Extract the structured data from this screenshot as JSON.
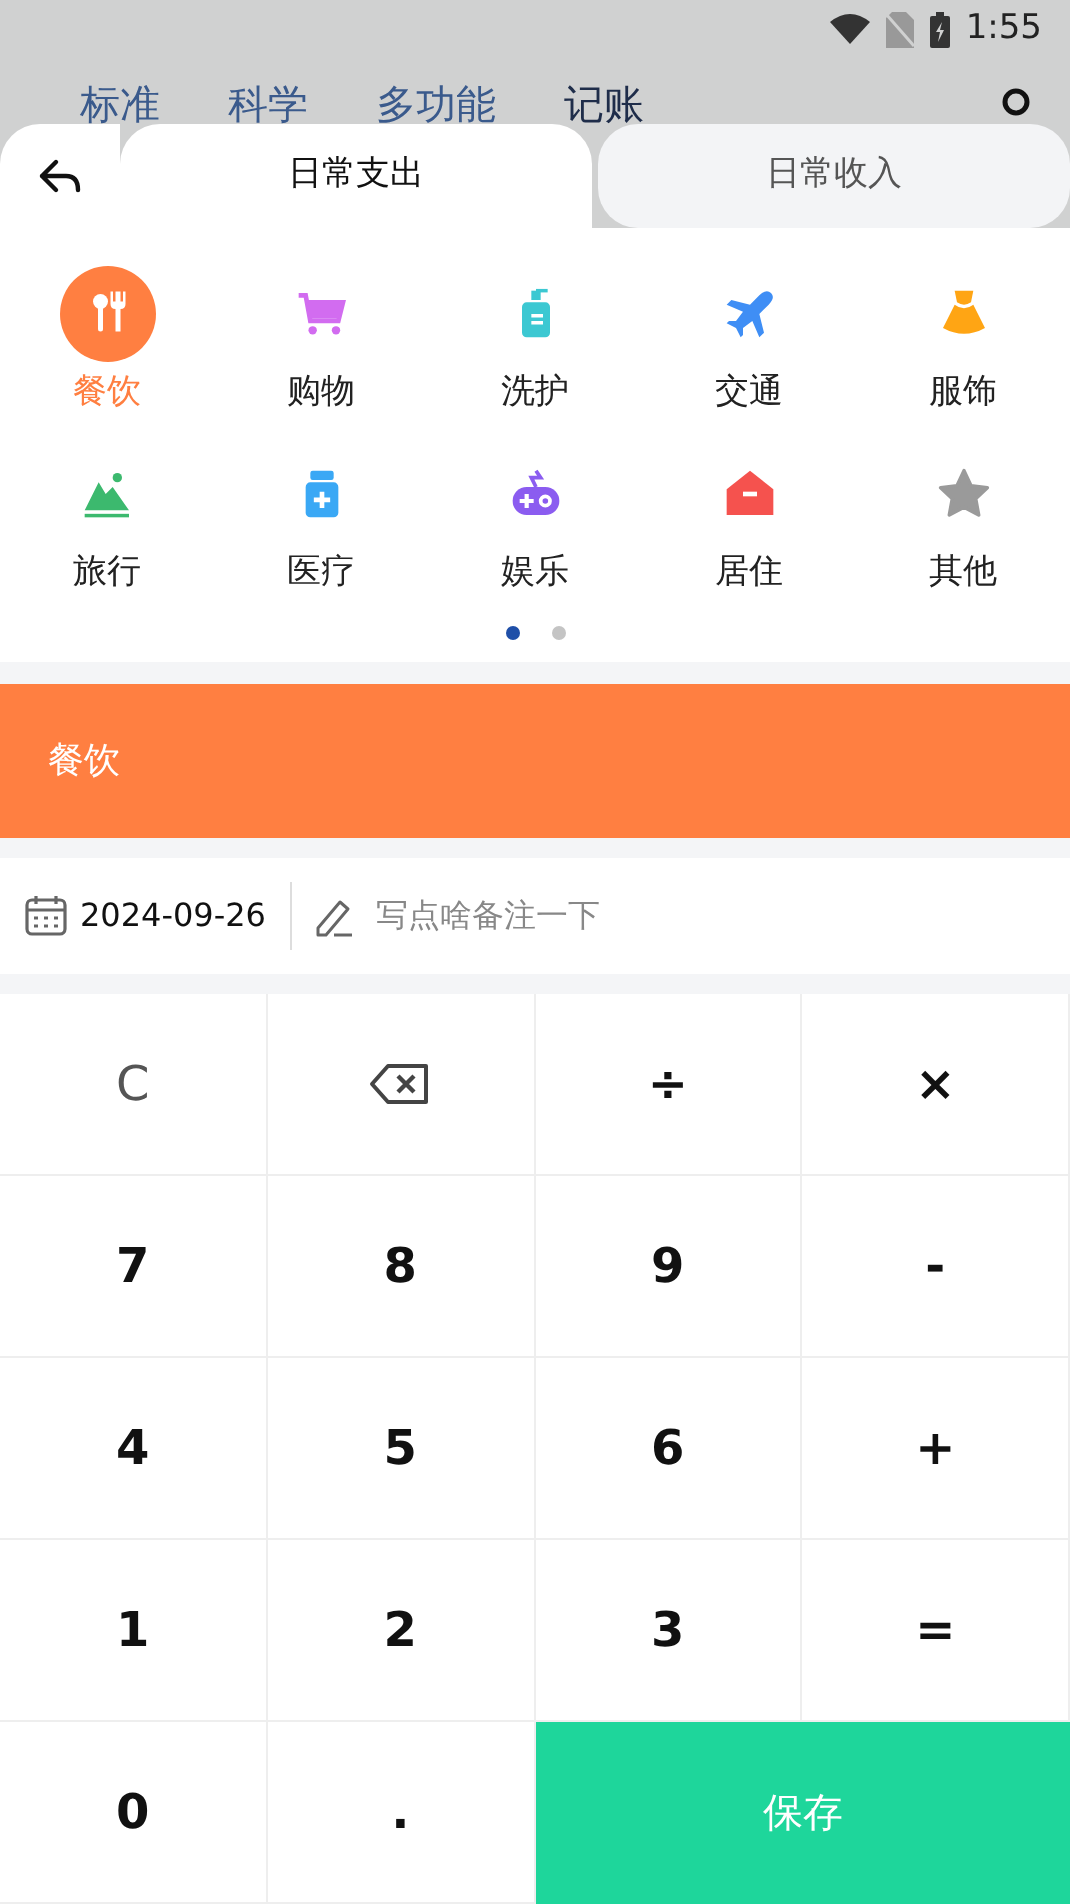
{
  "status_bar": {
    "time": "1:55"
  },
  "background_tabs": [
    {
      "label": "标准",
      "selected": false
    },
    {
      "label": "科学",
      "selected": false
    },
    {
      "label": "多功能",
      "selected": false
    },
    {
      "label": "记账",
      "selected": true
    }
  ],
  "tabs": [
    {
      "label": "日常支出",
      "selected": true
    },
    {
      "label": "日常收入",
      "selected": false
    }
  ],
  "categories": [
    {
      "label": "餐饮",
      "selected": true,
      "color": "#ff7f41"
    },
    {
      "label": "购物",
      "selected": false,
      "color": "#d26cf0"
    },
    {
      "label": "洗护",
      "selected": false,
      "color": "#3cc8d2"
    },
    {
      "label": "交通",
      "selected": false,
      "color": "#3f8ef5"
    },
    {
      "label": "服饰",
      "selected": false,
      "color": "#ffa514"
    },
    {
      "label": "旅行",
      "selected": false,
      "color": "#3cb96e"
    },
    {
      "label": "医疗",
      "selected": false,
      "color": "#3aa8f5"
    },
    {
      "label": "娱乐",
      "selected": false,
      "color": "#8b5cf0"
    },
    {
      "label": "居住",
      "selected": false,
      "color": "#f5524e"
    },
    {
      "label": "其他",
      "selected": false,
      "color": "#9a9a9a"
    }
  ],
  "page_dots": [
    {
      "selected": true
    },
    {
      "selected": false
    }
  ],
  "banner": {
    "label": "餐饮"
  },
  "entry": {
    "date": "2024-09-26",
    "placeholder": "写点啥备注一下"
  },
  "keypad": [
    {
      "kind": "text",
      "label": "C"
    },
    {
      "kind": "backspace"
    },
    {
      "kind": "text",
      "label": "÷"
    },
    {
      "kind": "text",
      "label": "×"
    },
    {
      "kind": "text",
      "label": "7"
    },
    {
      "kind": "text",
      "label": "8"
    },
    {
      "kind": "text",
      "label": "9"
    },
    {
      "kind": "text",
      "label": "-"
    },
    {
      "kind": "text",
      "label": "4"
    },
    {
      "kind": "text",
      "label": "5"
    },
    {
      "kind": "text",
      "label": "6"
    },
    {
      "kind": "text",
      "label": "+"
    },
    {
      "kind": "text",
      "label": "1"
    },
    {
      "kind": "text",
      "label": "2"
    },
    {
      "kind": "text",
      "label": "3"
    },
    {
      "kind": "text",
      "label": "="
    },
    {
      "kind": "text",
      "label": "0"
    },
    {
      "kind": "text",
      "label": "."
    },
    {
      "kind": "save",
      "label": "保存"
    }
  ]
}
